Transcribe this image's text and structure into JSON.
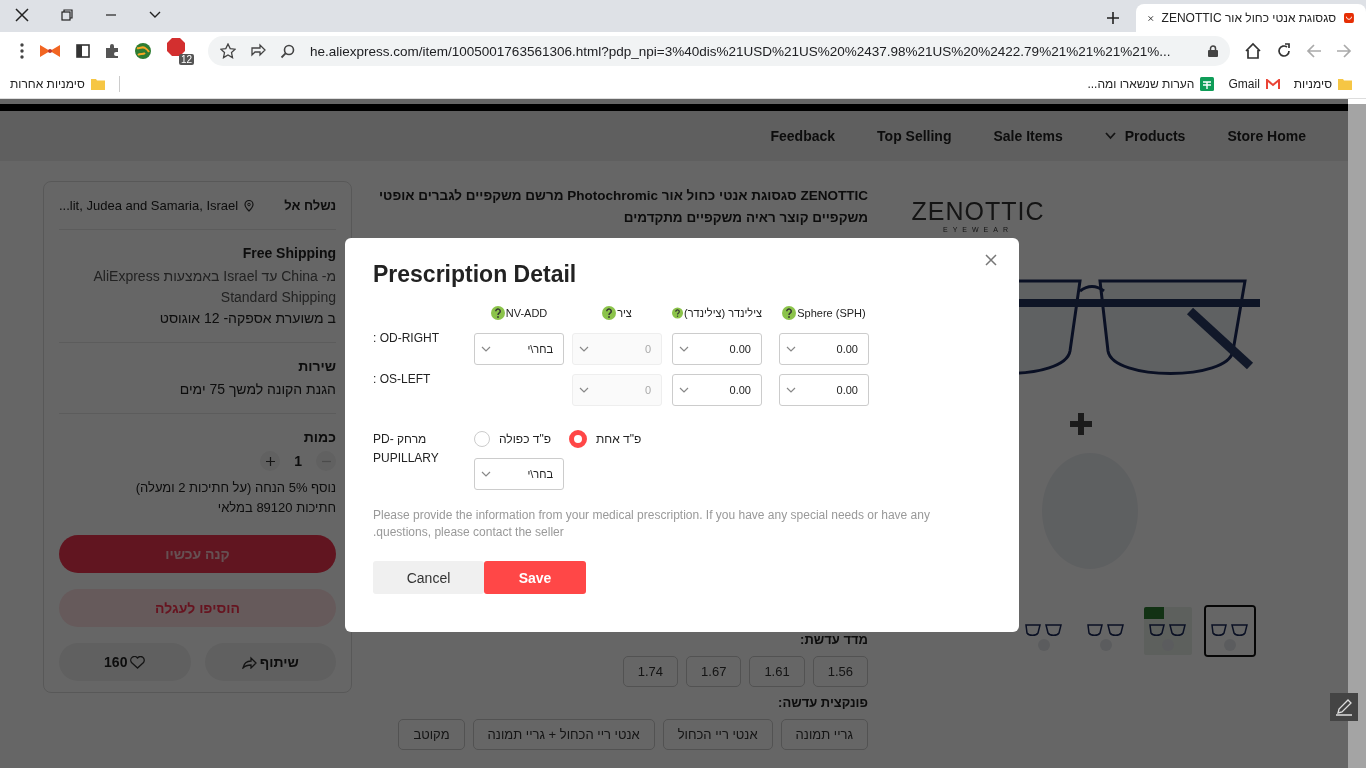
{
  "browser": {
    "tab": {
      "title": "סגסוגת אנטי כחול אור ZENOTTIC"
    },
    "url": "he.aliexpress.com/item/1005001763561306.html?pdp_npi=3%40dis%21USD%21US%20%2437.98%21US%20%2422.79%21%21%21%21%...",
    "extension_badge": "12",
    "bookmarks": [
      {
        "label": "סימניות",
        "kind": "folder"
      },
      {
        "label": "Gmail",
        "kind": "gmail"
      },
      {
        "label": "הערות שנשארו ומה...",
        "kind": "sheet"
      }
    ],
    "other_bookmarks": "סימניות אחרות"
  },
  "nav": [
    {
      "label": "Store Home",
      "dropdown": false
    },
    {
      "label": "Products",
      "dropdown": true
    },
    {
      "label": "Sale Items",
      "dropdown": false
    },
    {
      "label": "Top Selling",
      "dropdown": false
    },
    {
      "label": "Feedback",
      "dropdown": false
    }
  ],
  "purchase": {
    "ship_to_label": "נשלח אל",
    "ship_to": "...lit, Judea and Samaria, Israel",
    "shipping_title": "Free Shipping",
    "shipping_route": "מ- China עד Israel באמצעות AliExpress",
    "shipping_method": "Standard Shipping",
    "delivery": "ב משוערת אספקה- 12 אוגוסט",
    "service_title": "שירות",
    "service": "הגנת הקונה למשך 75 ימים",
    "quantity_title": "כמות",
    "quantity": "1",
    "discount": "נוסף 5% הנחה (על חתיכות 2 ומעלה)",
    "stock": "חתיכות 89120 במלאי",
    "buy_now": "קנה עכשיו",
    "add_to_cart": "הוסיפו לעגלה",
    "wishlist_count": "160",
    "share": "שיתוף"
  },
  "product": {
    "title": "ZENOTTIC סגסוגת אנטי כחול אור Photochromic מרשם משקפיים לגברים אופטי משקפיים קוצר ראיה משקפיים מתקדמים",
    "lens_index_label": "מדד עדשת:",
    "lens_index": [
      "1.56",
      "1.61",
      "1.67",
      "1.74"
    ],
    "lens_function_label": "פונקצית עדשה:",
    "lens_function": [
      "גריי תמונה",
      "אנטי ריי הכחול",
      "אנטי ריי הכחול + גריי תמונה",
      "מקוטב"
    ]
  },
  "gallery": {
    "brand": "ZENOTTIC",
    "brand_sub": "EYEWEAR",
    "thumbnails": [
      {
        "selected": false
      },
      {
        "selected": false
      },
      {
        "selected": false
      },
      {
        "selected": true
      }
    ]
  },
  "prescription": {
    "title": "Prescription Detail",
    "columns": [
      "Sphere (SPH)",
      "צילינדר (צילינדר)",
      "ציר",
      "NV-ADD"
    ],
    "rows": [
      {
        "label": "OD-RIGHT :",
        "cells": [
          {
            "value": "0.00",
            "disabled": false
          },
          {
            "value": "0.00",
            "disabled": false
          },
          {
            "value": "0",
            "disabled": true
          },
          {
            "value": "בחר\\י",
            "disabled": false
          }
        ]
      },
      {
        "label": "OS-LEFT :",
        "cells": [
          {
            "value": "0.00",
            "disabled": false
          },
          {
            "value": "0.00",
            "disabled": false
          },
          {
            "value": "0",
            "disabled": true
          }
        ]
      }
    ],
    "pd": {
      "label": "מרחק PD- PUPILLARY",
      "options": [
        {
          "label": "פ\"ד אחת",
          "selected": true
        },
        {
          "label": "פ\"ד כפולה",
          "selected": false
        }
      ],
      "value": "בחר\\י"
    },
    "note": "Please provide the information from your medical prescription. If you have any special needs or have any questions, please contact the seller.",
    "cancel": "Cancel",
    "save": "Save"
  }
}
